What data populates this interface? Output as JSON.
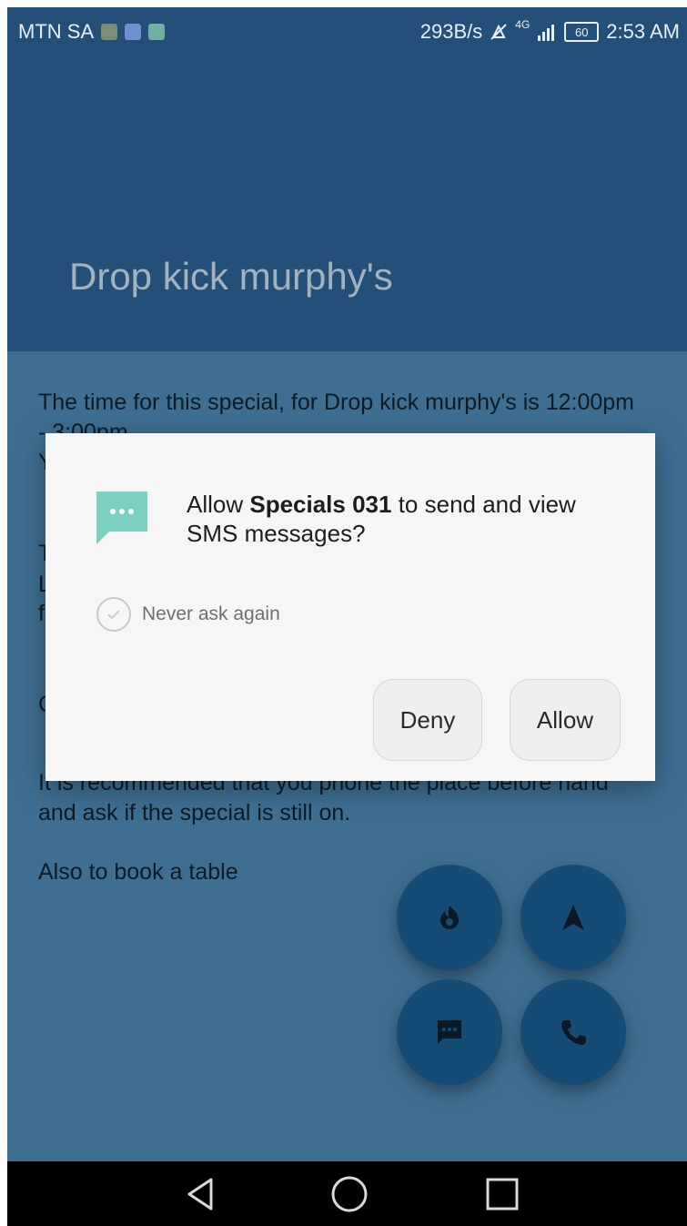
{
  "status_bar": {
    "carrier": "MTN SA",
    "net_speed": "293B/s",
    "network_type": "4G",
    "battery": "60",
    "time": "2:53 AM",
    "icons": [
      "photo-icon",
      "gallery-icon",
      "image-icon",
      "mute-icon",
      "signal-icon",
      "battery-icon"
    ]
  },
  "app_bar": {
    "title": "Drop kick murphy's"
  },
  "content": {
    "paragraph_1": "The time for this special, for Drop kick murphy's is 12:00pm - 3:00pm",
    "paragraph_2": "Y",
    "paragraph_3a": "T",
    "paragraph_3b": "L",
    "paragraph_3c": "f",
    "paragraph_4": "C",
    "paragraph_5": "It is recommended that you phone the place before hand and ask if the special is still on.",
    "paragraph_6": "Also to book a table"
  },
  "dialog": {
    "message_prefix": "Allow ",
    "app_name": "Specials 031",
    "message_suffix": " to send and view SMS messages?",
    "never_ask_label": "Never ask again",
    "deny_label": "Deny",
    "allow_label": "Allow",
    "icon_color": "#7ccfc3"
  },
  "fabs": [
    {
      "icon": "flame-icon"
    },
    {
      "icon": "navigation-icon"
    },
    {
      "icon": "sms-icon"
    },
    {
      "icon": "phone-icon"
    }
  ],
  "colors": {
    "app_bar": "#234f78",
    "content_bg": "#3e6f93",
    "fab": "#154c76"
  }
}
